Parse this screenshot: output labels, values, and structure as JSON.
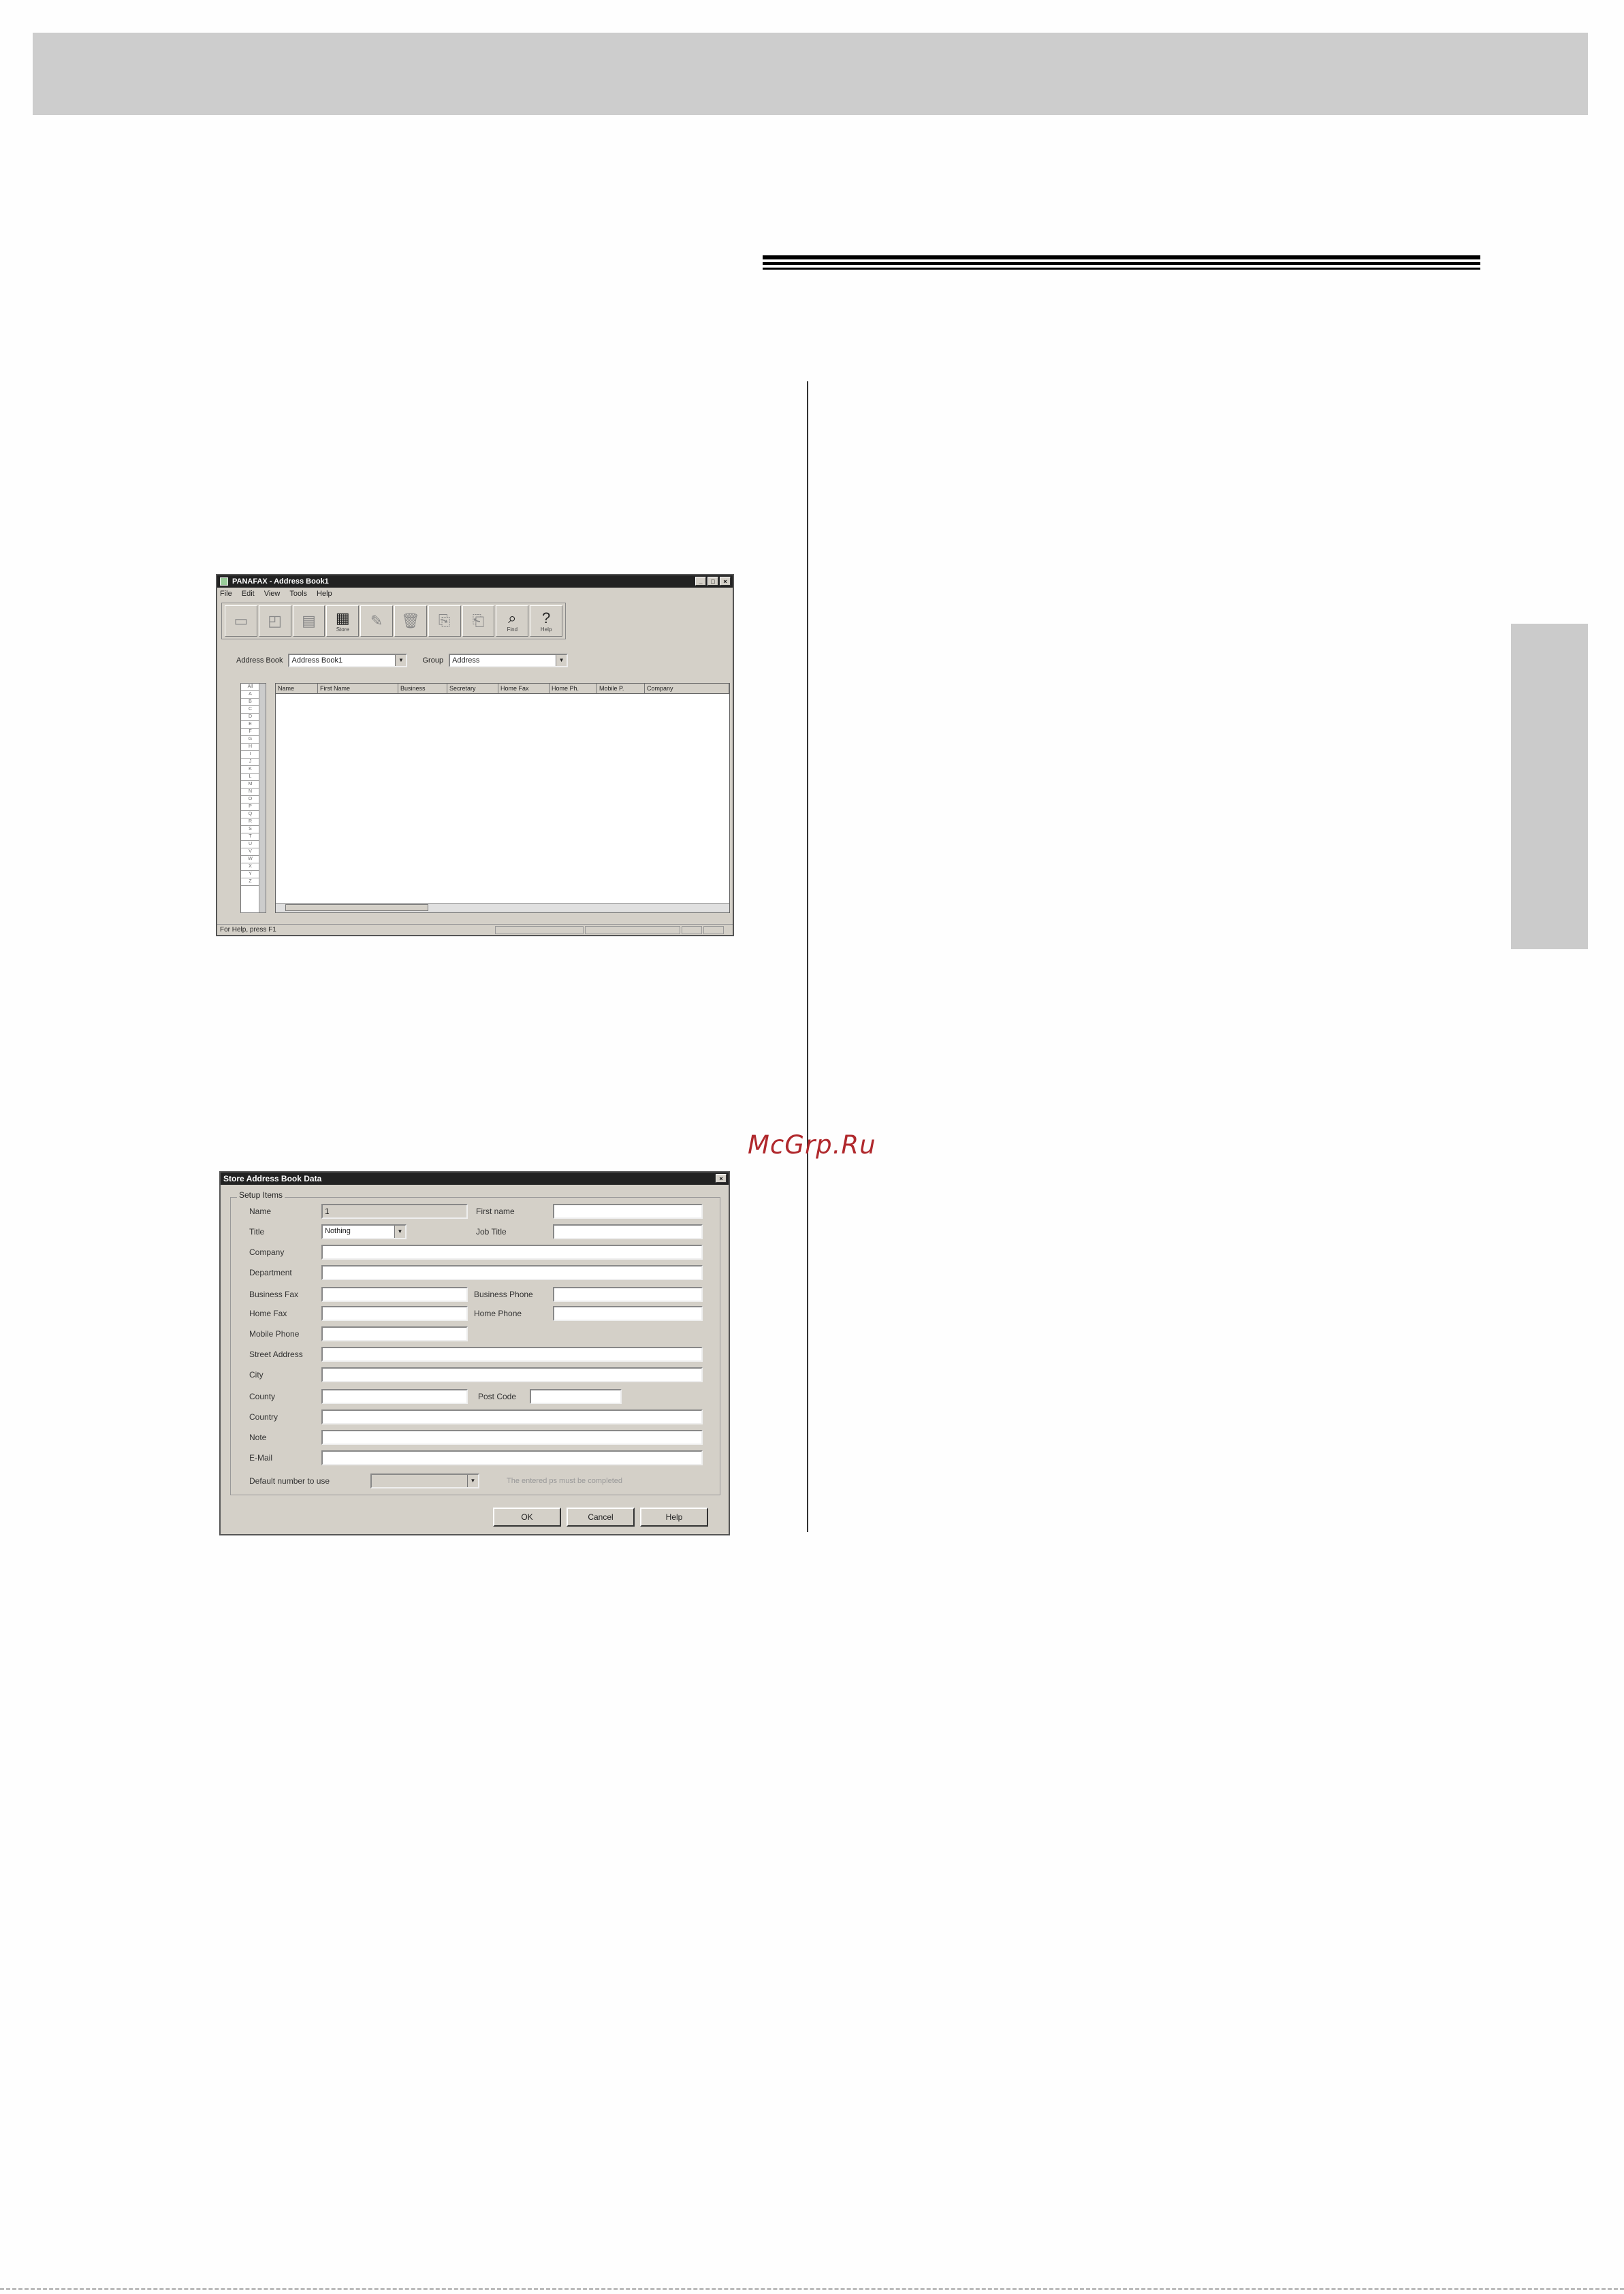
{
  "watermark": "McGrp.Ru",
  "address_book_window": {
    "title": "PANAFAX - Address Book1",
    "window_buttons": [
      "_",
      "□",
      "×"
    ],
    "menu": [
      "File",
      "Edit",
      "View",
      "Tools",
      "Help"
    ],
    "toolbar": [
      {
        "icon": "new-icon",
        "label": ""
      },
      {
        "icon": "open-icon",
        "label": ""
      },
      {
        "icon": "save-icon",
        "label": ""
      },
      {
        "icon": "new-entry-icon",
        "label": "Store"
      },
      {
        "icon": "edit-icon",
        "label": ""
      },
      {
        "icon": "delete-icon",
        "label": ""
      },
      {
        "icon": "copy-icon",
        "label": ""
      },
      {
        "icon": "paste-icon",
        "label": ""
      },
      {
        "icon": "find-icon",
        "label": "Find"
      },
      {
        "icon": "help-icon",
        "label": "Help"
      }
    ],
    "address_book_label": "Address Book",
    "address_book_value": "Address Book1",
    "group_label": "Group",
    "group_value": "Address",
    "index_tabs": [
      "All",
      "A",
      "B",
      "C",
      "D",
      "E",
      "F",
      "G",
      "H",
      "I",
      "J",
      "K",
      "L",
      "M",
      "N",
      "O",
      "P",
      "Q",
      "R",
      "S",
      "T",
      "U",
      "V",
      "W",
      "X",
      "Y",
      "Z"
    ],
    "columns": [
      "Name",
      "First Name",
      "Business",
      "Secretary",
      "Home Fax",
      "Home Ph.",
      "Mobile P.",
      "Company"
    ],
    "status_text": "For Help, press F1"
  },
  "store_dialog": {
    "title": "Store Address Book Data",
    "close": "×",
    "group_label": "Setup Items",
    "labels": {
      "name": "Name",
      "first_name": "First name",
      "title": "Title",
      "job_title": "Job Title",
      "company": "Company",
      "department": "Department",
      "business_fax": "Business Fax",
      "business_phone": "Business Phone",
      "home_fax": "Home Fax",
      "home_phone": "Home Phone",
      "mobile_phone": "Mobile Phone",
      "street_address": "Street Address",
      "city": "City",
      "county": "County",
      "post_code": "Post Code",
      "country": "Country",
      "note": "Note",
      "email": "E-Mail",
      "default_number": "Default number to use"
    },
    "name_value": "1",
    "title_value": "Nothing",
    "hint": "The entered ps must be completed",
    "buttons": {
      "ok": "OK",
      "cancel": "Cancel",
      "help": "Help"
    }
  }
}
